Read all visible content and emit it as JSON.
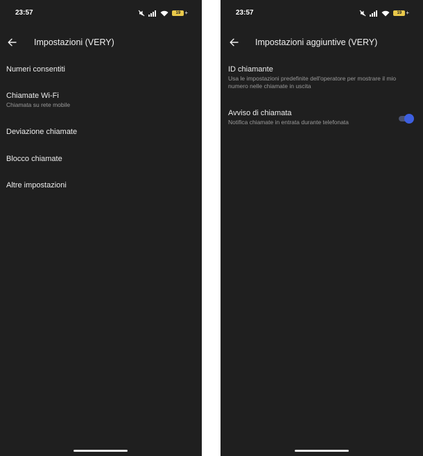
{
  "left_screen": {
    "status_bar": {
      "time": "23:57",
      "battery": "19",
      "battery_charging_symbol": "+"
    },
    "app_bar": {
      "title": "Impostazioni (VERY)",
      "back_icon": "arrow-left-icon"
    },
    "menu_items": [
      {
        "label": "Numeri consentiti"
      },
      {
        "label": "Chiamate Wi-Fi",
        "sublabel": "Chiamata su rete mobile"
      },
      {
        "label": "Deviazione chiamate"
      },
      {
        "label": "Blocco chiamate"
      },
      {
        "label": "Altre impostazioni"
      }
    ]
  },
  "right_screen": {
    "status_bar": {
      "time": "23:57",
      "battery": "19",
      "battery_charging_symbol": "+"
    },
    "app_bar": {
      "title": "Impostazioni aggiuntive (VERY)",
      "back_icon": "arrow-left-icon"
    },
    "settings": [
      {
        "label": "ID chiamante",
        "description": "Usa le impostazioni predefinite dell'operatore per mostrare il mio numero nelle chiamate in uscita"
      },
      {
        "label": "Avviso di chiamata",
        "description": "Notifica chiamate in entrata durante telefonata",
        "toggle_on": true
      }
    ]
  },
  "colors": {
    "screen_background": "#1f1f1f",
    "toggle_accent": "#3d5fe0",
    "battery_fill": "#e9c84a"
  }
}
